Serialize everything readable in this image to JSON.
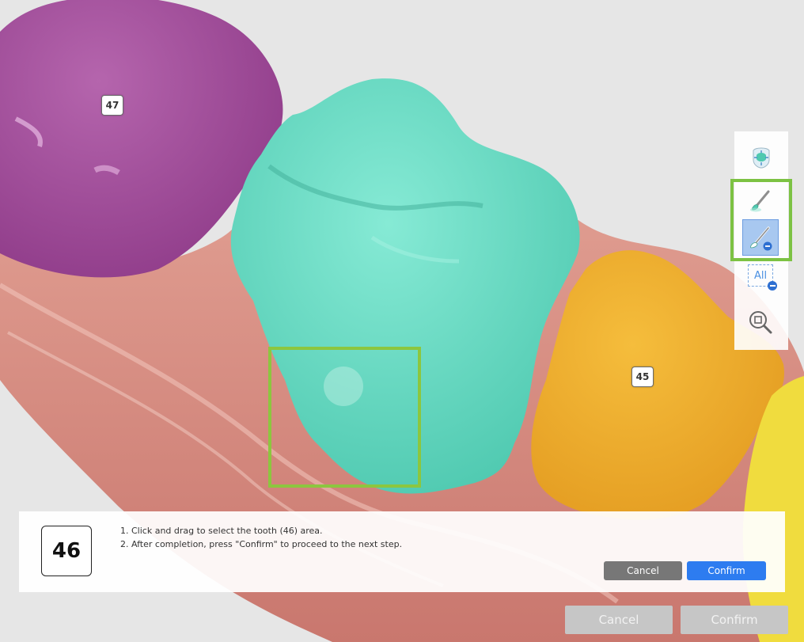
{
  "teeth": {
    "tooth_47": {
      "label": "47",
      "color": "#a44d9e"
    },
    "tooth_46": {
      "color": "#6fdcc4"
    },
    "tooth_45": {
      "label": "45",
      "color": "#eeb02e"
    },
    "tooth_44": {
      "color": "#f0dc3e"
    },
    "gingiva_color": "#d98a80"
  },
  "selection_box": {
    "color": "#8cc63f"
  },
  "toolbar": {
    "tools": [
      {
        "name": "fit-view-icon"
      },
      {
        "name": "brush-add-icon"
      },
      {
        "name": "brush-remove-icon",
        "active": true
      },
      {
        "name": "remove-all-icon",
        "label": "All"
      },
      {
        "name": "zoom-fit-icon"
      }
    ],
    "highlight_color": "#7cc243"
  },
  "instruction_panel": {
    "tooth_number": "46",
    "line1": "1. Click and drag to select the tooth (46) area.",
    "line2": "2. After completion, press \"Confirm\" to proceed to the next step.",
    "cancel_label": "Cancel",
    "confirm_label": "Confirm"
  },
  "footer": {
    "cancel_label": "Cancel",
    "confirm_label": "Confirm"
  }
}
